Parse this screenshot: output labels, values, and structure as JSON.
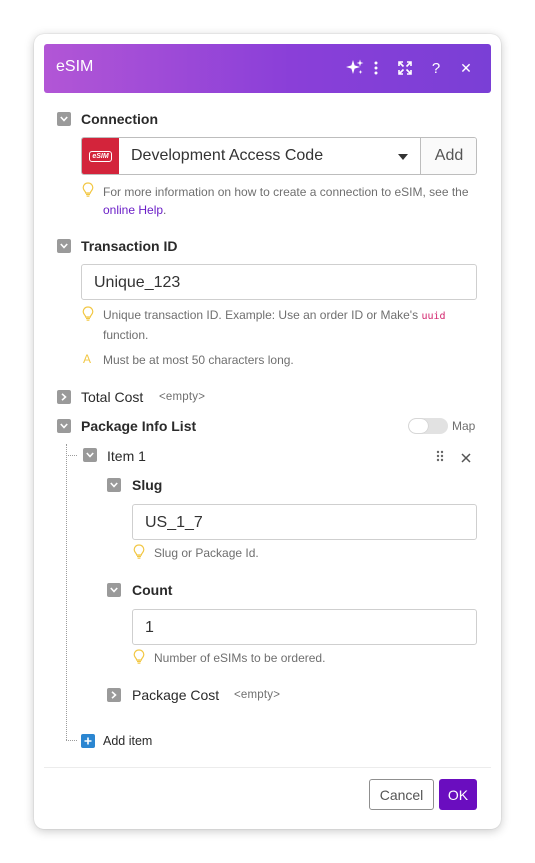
{
  "colors": {
    "header_gradient_start": "#b256d6",
    "header_gradient_end": "#7a3fd6",
    "ok_button": "#6a0dbf",
    "link": "#6b1fc7",
    "uuid_code": "#d3246d",
    "esim_logo": "#d3243b",
    "add_item_icon": "#2b86d1"
  },
  "header": {
    "title": "eSIM",
    "icons": [
      "sparkle-icon",
      "more-vertical-icon",
      "expand-icon",
      "help-icon",
      "close-icon"
    ],
    "help_glyph": "?",
    "close_glyph": "✕"
  },
  "connection": {
    "label": "Connection",
    "logo_text": "eSIM",
    "value": "Development Access Code",
    "add_label": "Add",
    "hint_prefix": "For more information on how to create a connection to eSIM, see the",
    "hint_link": "online Help",
    "hint_suffix": "."
  },
  "transaction_id": {
    "label": "Transaction ID",
    "value": "Unique_123",
    "hint_prefix": "Unique transaction ID. Example: Use an order ID or Make's",
    "hint_code": "uuid",
    "hint_suffix": "function.",
    "warning_glyph": "A",
    "warning": "Must be at most 50 characters long."
  },
  "total_cost": {
    "label": "Total Cost",
    "value": "<empty>"
  },
  "package_info_list": {
    "label": "Package Info List",
    "map_label": "Map",
    "item": {
      "label": "Item 1",
      "slug": {
        "label": "Slug",
        "value": "US_1_7",
        "hint": "Slug or Package Id."
      },
      "count": {
        "label": "Count",
        "value": "1",
        "hint": "Number of eSIMs to be ordered."
      },
      "package_cost": {
        "label": "Package Cost",
        "value": "<empty>"
      }
    },
    "add_item_label": "Add item"
  },
  "footer": {
    "cancel_label": "Cancel",
    "ok_label": "OK"
  }
}
